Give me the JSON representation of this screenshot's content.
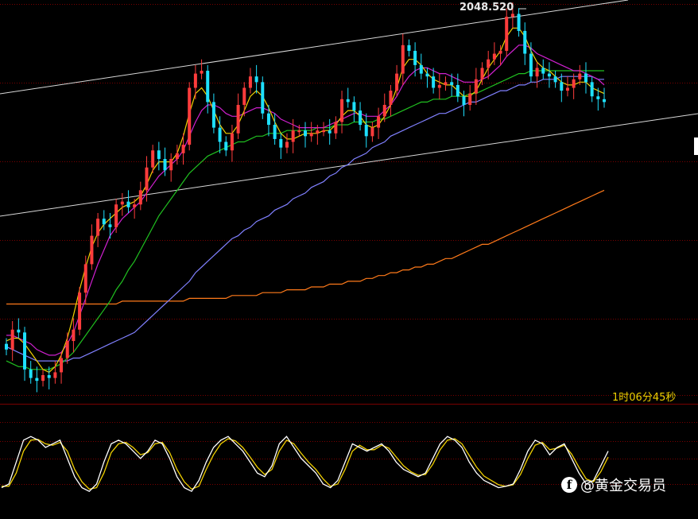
{
  "chart_data": {
    "type": "candlestick",
    "title": "",
    "high_label": "2048.520",
    "countdown": "1时06分45秒",
    "colors": {
      "background": "#000000",
      "grid": "#7a0000",
      "bull": "#ff3c3c",
      "bear": "#1ee0ff",
      "ma_fast": "#ffffff",
      "ma_yellow": "#f0d000",
      "ma_magenta": "#d020d0",
      "ma_green": "#20c020",
      "ma_blue": "#8080ff",
      "ma_orange": "#ff7a1a",
      "channel": "#d8d8d8",
      "osc_k": "#ffffff",
      "osc_d": "#f0d000"
    },
    "close": [
      1929,
      1936,
      1935,
      1922,
      1919,
      1918,
      1920,
      1919,
      1921,
      1926,
      1932,
      1936,
      1949,
      1959,
      1969,
      1975,
      1973,
      1972,
      1980,
      1981,
      1979,
      1980,
      1985,
      1993,
      1999,
      1996,
      1992,
      1996,
      1998,
      2001,
      2021,
      2026,
      2027,
      2016,
      2007,
      2002,
      1999,
      2005,
      2015,
      2021,
      2025,
      2023,
      2012,
      2008,
      2003,
      2000,
      2002,
      2006,
      2006,
      2004,
      2005,
      2006,
      2006,
      2005,
      2009,
      2017,
      2016,
      2013,
      2008,
      2004,
      2007,
      2011,
      2015,
      2020,
      2026,
      2036,
      2034,
      2029,
      2026,
      2025,
      2021,
      2022,
      2023,
      2022,
      2018,
      2015,
      2019,
      2024,
      2028,
      2031,
      2033,
      2034,
      2046,
      2047,
      2041,
      2033,
      2025,
      2028,
      2026,
      2025,
      2023,
      2020,
      2021,
      2024,
      2026,
      2023,
      2018,
      2017,
      2016
    ],
    "ma_yellow": [
      1932,
      1933,
      1933,
      1931,
      1928,
      1925,
      1922,
      1921,
      1923,
      1927,
      1933,
      1941,
      1950,
      1958,
      1965,
      1970,
      1973,
      1975,
      1977,
      1979,
      1980,
      1981,
      1983,
      1987,
      1992,
      1995,
      1995,
      1995,
      1998,
      2004,
      2012,
      2019,
      2021,
      2018,
      2013,
      2008,
      2005,
      2005,
      2008,
      2013,
      2018,
      2020,
      2018,
      2014,
      2009,
      2005,
      2003,
      2003,
      2004,
      2005,
      2005,
      2005,
      2006,
      2006,
      2008,
      2011,
      2013,
      2013,
      2011,
      2008,
      2007,
      2008,
      2011,
      2015,
      2021,
      2028,
      2031,
      2031,
      2029,
      2026,
      2024,
      2023,
      2022,
      2022,
      2020,
      2018,
      2018,
      2020,
      2024,
      2028,
      2031,
      2034,
      2039,
      2042,
      2042,
      2039,
      2034,
      2030,
      2028,
      2027,
      2025,
      2023,
      2022,
      2022,
      2023,
      2023,
      2021,
      2020,
      2019
    ],
    "ma_magenta": [
      1934,
      1934,
      1933,
      1932,
      1931,
      1929,
      1928,
      1927,
      1927,
      1928,
      1931,
      1935,
      1941,
      1947,
      1953,
      1959,
      1964,
      1969,
      1972,
      1975,
      1977,
      1979,
      1981,
      1984,
      1987,
      1990,
      1992,
      1994,
      1996,
      1999,
      2004,
      2009,
      2013,
      2015,
      2015,
      2014,
      2012,
      2011,
      2011,
      2012,
      2013,
      2014,
      2014,
      2013,
      2012,
      2010,
      2009,
      2008,
      2007,
      2007,
      2007,
      2007,
      2007,
      2008,
      2009,
      2010,
      2011,
      2012,
      2012,
      2011,
      2011,
      2011,
      2013,
      2015,
      2018,
      2022,
      2025,
      2027,
      2028,
      2028,
      2027,
      2026,
      2026,
      2025,
      2024,
      2023,
      2023,
      2023,
      2024,
      2025,
      2027,
      2029,
      2032,
      2034,
      2036,
      2036,
      2035,
      2033,
      2032,
      2031,
      2030,
      2029,
      2028,
      2027,
      2027,
      2026,
      2025,
      2024,
      2022
    ],
    "ma_green": [
      1925,
      1924,
      1923,
      1923,
      1922,
      1922,
      1922,
      1922,
      1923,
      1924,
      1926,
      1928,
      1931,
      1934,
      1937,
      1940,
      1943,
      1946,
      1950,
      1953,
      1957,
      1960,
      1964,
      1968,
      1972,
      1976,
      1979,
      1982,
      1985,
      1988,
      1991,
      1993,
      1995,
      1997,
      1998,
      1999,
      2000,
      2001,
      2002,
      2002,
      2003,
      2004,
      2004,
      2005,
      2005,
      2005,
      2006,
      2006,
      2006,
      2006,
      2006,
      2007,
      2007,
      2007,
      2008,
      2008,
      2008,
      2009,
      2009,
      2009,
      2009,
      2010,
      2010,
      2011,
      2012,
      2013,
      2014,
      2015,
      2016,
      2016,
      2017,
      2017,
      2017,
      2018,
      2018,
      2018,
      2019,
      2019,
      2020,
      2021,
      2022,
      2023,
      2024,
      2025,
      2026,
      2026,
      2027,
      2027,
      2027,
      2027,
      2027,
      2027,
      2027,
      2027,
      2027,
      2027,
      2027,
      2027,
      2027
    ],
    "ma_blue": [
      1930,
      1929,
      1928,
      1927,
      1926,
      1925,
      1925,
      1925,
      1925,
      1925,
      1925,
      1926,
      1926,
      1927,
      1928,
      1929,
      1930,
      1931,
      1932,
      1933,
      1934,
      1935,
      1937,
      1939,
      1941,
      1943,
      1945,
      1947,
      1949,
      1951,
      1953,
      1956,
      1958,
      1960,
      1962,
      1964,
      1966,
      1968,
      1969,
      1971,
      1972,
      1974,
      1975,
      1976,
      1978,
      1979,
      1980,
      1982,
      1983,
      1984,
      1986,
      1987,
      1988,
      1990,
      1991,
      1993,
      1994,
      1996,
      1997,
      1998,
      2000,
      2001,
      2002,
      2004,
      2005,
      2006,
      2007,
      2008,
      2009,
      2010,
      2011,
      2012,
      2012,
      2013,
      2014,
      2015,
      2016,
      2016,
      2017,
      2018,
      2019,
      2020,
      2020,
      2021,
      2022,
      2022,
      2023,
      2023,
      2024,
      2024,
      2024,
      2025,
      2025,
      2025,
      2025,
      2025,
      2025,
      2024,
      2024
    ],
    "ma_orange": [
      1945,
      1945,
      1945,
      1945,
      1945,
      1945,
      1945,
      1945,
      1945,
      1945,
      1945,
      1945,
      1945,
      1945,
      1945,
      1945,
      1945,
      1945,
      1945,
      1946,
      1946,
      1946,
      1946,
      1946,
      1946,
      1946,
      1946,
      1946,
      1946,
      1946,
      1947,
      1947,
      1947,
      1947,
      1947,
      1947,
      1947,
      1948,
      1948,
      1948,
      1948,
      1948,
      1949,
      1949,
      1949,
      1949,
      1950,
      1950,
      1950,
      1950,
      1951,
      1951,
      1951,
      1952,
      1952,
      1952,
      1953,
      1953,
      1953,
      1954,
      1954,
      1955,
      1955,
      1956,
      1956,
      1957,
      1957,
      1958,
      1958,
      1959,
      1959,
      1960,
      1961,
      1961,
      1962,
      1963,
      1964,
      1965,
      1966,
      1966,
      1967,
      1968,
      1969,
      1970,
      1971,
      1972,
      1973,
      1974,
      1975,
      1976,
      1977,
      1978,
      1979,
      1980,
      1981,
      1982,
      1983,
      1984,
      1985
    ],
    "osc_k": [
      20,
      25,
      55,
      85,
      90,
      85,
      75,
      80,
      85,
      60,
      35,
      20,
      15,
      25,
      55,
      80,
      85,
      80,
      70,
      60,
      70,
      85,
      80,
      60,
      35,
      20,
      15,
      30,
      55,
      75,
      85,
      90,
      80,
      70,
      55,
      40,
      35,
      50,
      80,
      90,
      75,
      60,
      50,
      40,
      25,
      20,
      30,
      55,
      80,
      75,
      70,
      75,
      80,
      70,
      55,
      45,
      40,
      35,
      40,
      60,
      80,
      90,
      85,
      75,
      55,
      40,
      30,
      25,
      20,
      22,
      25,
      45,
      70,
      85,
      80,
      65,
      75,
      80,
      60,
      40,
      25,
      30,
      50,
      70
    ],
    "osc_d": [
      22,
      22,
      40,
      70,
      85,
      86,
      80,
      78,
      82,
      70,
      45,
      28,
      18,
      20,
      40,
      68,
      80,
      82,
      75,
      65,
      68,
      80,
      82,
      68,
      45,
      28,
      18,
      22,
      45,
      65,
      80,
      87,
      84,
      75,
      62,
      48,
      38,
      45,
      70,
      85,
      80,
      67,
      55,
      45,
      32,
      22,
      25,
      45,
      70,
      78,
      72,
      72,
      78,
      74,
      62,
      50,
      42,
      37,
      38,
      52,
      72,
      85,
      87,
      80,
      64,
      48,
      36,
      30,
      24,
      22,
      24,
      38,
      60,
      78,
      82,
      72,
      74,
      78,
      66,
      48,
      32,
      28,
      42,
      62
    ]
  }
}
